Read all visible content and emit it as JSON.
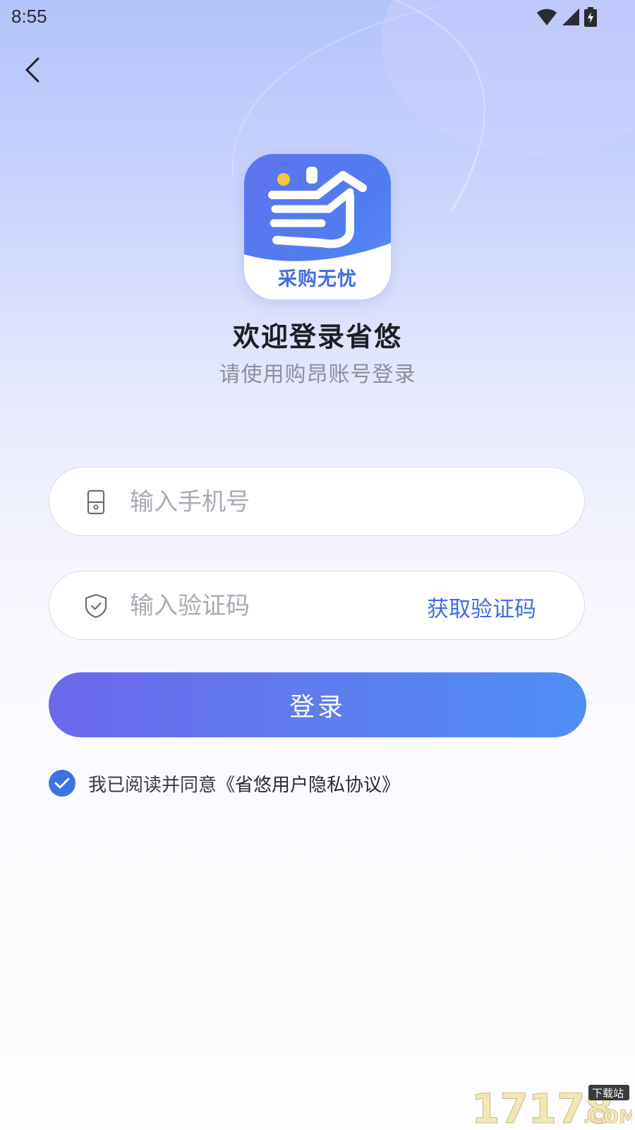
{
  "status_bar": {
    "time": "8:55"
  },
  "logo": {
    "text": "采购无忧"
  },
  "header": {
    "title": "欢迎登录省悠",
    "subtitle": "请使用购昂账号登录"
  },
  "phone_field": {
    "placeholder": "输入手机号",
    "icon": "phone-icon"
  },
  "code_field": {
    "placeholder": "输入验证码",
    "icon": "shield-icon",
    "get_code_label": "获取验证码"
  },
  "login_button": {
    "label": "登录"
  },
  "agreement": {
    "checked": true,
    "text": "我已阅读并同意",
    "link": "《省悠用户隐私协议》"
  },
  "watermark": {
    "text": "17178",
    "tag": "下载站",
    "suffix": ".COM"
  },
  "colors": {
    "accent": "#3f6fe0",
    "button_start": "#6d68ea",
    "button_end": "#4f8ef4"
  }
}
